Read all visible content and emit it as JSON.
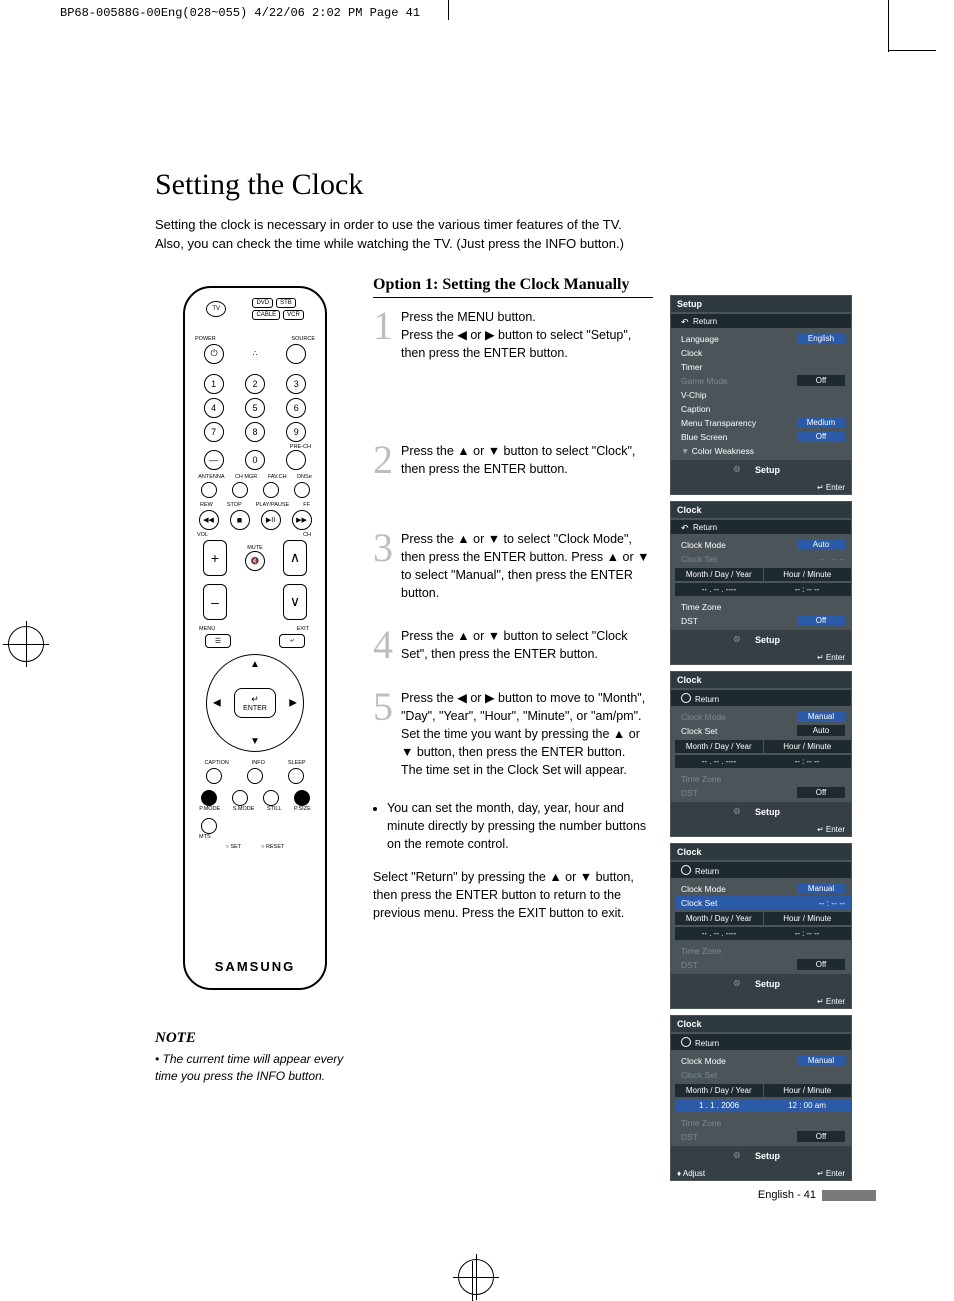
{
  "print_header": "BP68-00588G-00Eng(028~055)  4/22/06  2:02 PM  Page 41",
  "title": "Setting the Clock",
  "intro_l1": "Setting the clock is necessary in order to use the various timer features of the TV.",
  "intro_l2": "Also, you can check the time while watching the TV. (Just press the INFO button.)",
  "option_title": "Option 1: Setting the Clock Manually",
  "steps": {
    "s1": "Press the MENU button.\nPress the ◀ or ▶ button to select \"Setup\", then press the ENTER button.",
    "s2": "Press the ▲ or ▼ button to select \"Clock\", then press the ENTER button.",
    "s3": "Press the ▲ or ▼ to select \"Clock Mode\", then press the ENTER button. Press ▲ or ▼ to select \"Manual\", then press the ENTER button.",
    "s4": "Press the ▲ or ▼ button to select \"Clock Set\", then press the ENTER button.",
    "s5": "Press the ◀ or ▶ button to move to \"Month\", \"Day\", \"Year\", \"Hour\", \"Minute\", or \"am/pm\".\nSet the time you want by pressing the ▲ or ▼ button, then press the ENTER button.\nThe time set in the Clock Set will appear.",
    "s5_bullet": "You can set the month, day, year, hour and minute directly by pressing the number buttons on the remote control.",
    "s5_trail": "Select \"Return\" by pressing the ▲ or ▼ button, then press the ENTER button to return to the previous menu. Press the EXIT button to exit."
  },
  "note": {
    "title": "NOTE",
    "body": "The current time will appear every time you press the INFO button."
  },
  "remote": {
    "brand": "SAMSUNG",
    "top_row": [
      "DVD",
      "STB"
    ],
    "top_row2": [
      "CABLE",
      "VCR"
    ],
    "tv": "TV",
    "power": "POWER",
    "source": "SOURCE",
    "antenna": "ANTENNA",
    "chmgr": "CH MGR",
    "favch": "FAV.CH",
    "dnse": "DNSe",
    "rew": "REW",
    "stop": "STOP",
    "play": "PLAY/PAUSE",
    "ff": "FF",
    "vol": "VOL",
    "ch": "CH",
    "mute": "MUTE",
    "prech": "PRE-CH",
    "menu": "MENU",
    "exit": "EXIT",
    "enter": "ENTER",
    "caption": "CAPTION",
    "info": "INFO",
    "sleep": "SLEEP",
    "pmode": "P.MODE",
    "smode": "S.MODE",
    "still": "STILL",
    "psize": "P.SIZE",
    "mts": "MTS",
    "set": "SET",
    "reset": "RESET"
  },
  "osd": {
    "setup": {
      "title": "Setup",
      "return": "Return",
      "rows": [
        {
          "l": "Language",
          "v": "English"
        },
        {
          "l": "Clock",
          "v": ""
        },
        {
          "l": "Timer",
          "v": ""
        },
        {
          "l": "Game Mode",
          "v": "Off",
          "dim": true
        },
        {
          "l": "V-Chip",
          "v": ""
        },
        {
          "l": "Caption",
          "v": ""
        },
        {
          "l": "Menu Transparency",
          "v": "Medium"
        },
        {
          "l": "Blue Screen",
          "v": "Off"
        },
        {
          "l": "Color Weakness",
          "v": "",
          "down": true
        }
      ],
      "foot": "Setup",
      "enter": "Enter"
    },
    "clock1": {
      "title": "Clock",
      "return": "Return",
      "clockmode": "Clock Mode",
      "cm_val": "Auto",
      "clockset": "Clock Set",
      "cs_val": "-- : -- --",
      "hdr": [
        "Month / Day / Year",
        "Hour / Minute"
      ],
      "vals": [
        "--  .  --  . ----",
        "--  :  --    --"
      ],
      "tz": "Time Zone",
      "dst": "DST",
      "dst_val": "Off",
      "foot": "Setup",
      "enter": "Enter"
    },
    "clock2": {
      "title": "Clock",
      "return": "Return",
      "clockmode": "Clock Mode",
      "cm_val": "Manual",
      "cm_opt": "Auto",
      "clockset": "Clock Set",
      "hdr": [
        "Month / Day / Year",
        "Hour / Minute"
      ],
      "vals": [
        "--  .  --  . ----",
        "--  :  --    --"
      ],
      "tz": "Time Zone",
      "dst": "DST",
      "dst_val": "Off",
      "foot": "Setup",
      "enter": "Enter"
    },
    "clock3": {
      "title": "Clock",
      "return": "Return",
      "clockmode": "Clock Mode",
      "cm_val": "Manual",
      "clockset": "Clock Set",
      "cs_val": "-- : -- --",
      "hdr": [
        "Month / Day / Year",
        "Hour / Minute"
      ],
      "vals": [
        "--  .  --  . ----",
        "--  :  --    --"
      ],
      "tz": "Time Zone",
      "dst": "DST",
      "dst_val": "Off",
      "foot": "Setup",
      "enter": "Enter"
    },
    "clock4": {
      "title": "Clock",
      "return": "Return",
      "clockmode": "Clock Mode",
      "cm_val": "Manual",
      "clockset": "Clock Set",
      "hdr": [
        "Month / Day / Year",
        "Hour / Minute"
      ],
      "vals": [
        "1   .   1  . 2006",
        "12  :  00    am"
      ],
      "tz": "Time Zone",
      "dst": "DST",
      "dst_val": "Off",
      "foot": "Setup",
      "enter": "Enter",
      "adjust": "Adjust"
    }
  },
  "footer": "English - 41"
}
